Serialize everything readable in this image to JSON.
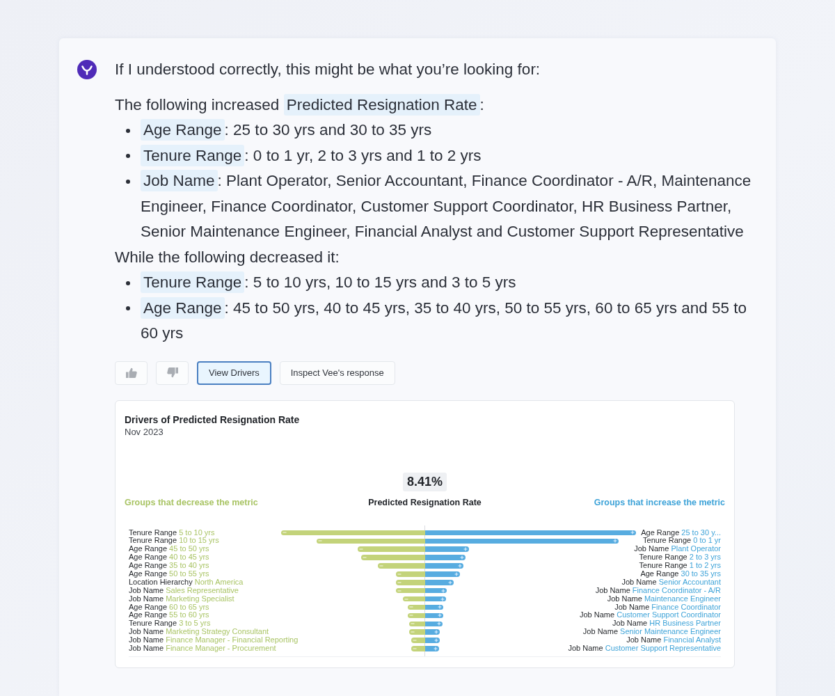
{
  "message": {
    "intro": "If I understood correctly, this might be what you’re looking for:",
    "sections": [
      {
        "lead": "The following increased",
        "metric": "Predicted Resignation Rate",
        "tail": ":",
        "items": [
          {
            "field": "Age Range",
            "text": ": 25 to 30 yrs and 30 to 35 yrs"
          },
          {
            "field": "Tenure Range",
            "text": ": 0 to 1 yr, 2 to 3 yrs and 1 to 2 yrs"
          },
          {
            "field": "Job Name",
            "text": ": Plant Operator, Senior Accountant, Finance Coordinator - A/R, Maintenance Engineer, Finance Coordinator, Customer Support Coordinator, HR Business Partner, Senior Maintenance Engineer, Financial Analyst and Customer Support Representative"
          }
        ]
      },
      {
        "lead": "While the following decreased it:",
        "items": [
          {
            "field": "Tenure Range",
            "text": ": 5 to 10 yrs, 10 to 15 yrs and 3 to 5 yrs"
          },
          {
            "field": "Age Range",
            "text": ": 45 to 50 yrs, 40 to 45 yrs, 35 to 40 yrs, 50 to 55 yrs, 60 to 65 yrs and 55 to 60 yrs"
          }
        ]
      }
    ]
  },
  "actions": [
    {
      "label": "View Drivers",
      "selected": true
    },
    {
      "label": "Inspect Vee's response",
      "selected": false
    }
  ],
  "chart": {
    "title": "Drivers of Predicted Resignation Rate",
    "period": "Nov 2023",
    "value": "8.41%",
    "metric": "Predicted Resignation Rate",
    "decrease_heading": "Groups that decrease the metric",
    "increase_heading": "Groups that increase the metric",
    "decrease_groups": [
      {
        "attribute": "Tenure Range",
        "group": "5 to 10 yrs"
      },
      {
        "attribute": "Tenure Range",
        "group": "10 to 15 yrs"
      },
      {
        "attribute": "Age Range",
        "group": "45 to 50 yrs"
      },
      {
        "attribute": "Age Range",
        "group": "40 to 45 yrs"
      },
      {
        "attribute": "Age Range",
        "group": "35 to 40 yrs"
      },
      {
        "attribute": "Age Range",
        "group": "50 to 55 yrs"
      },
      {
        "attribute": "Location Hierarchy",
        "group": "North America"
      },
      {
        "attribute": "Job Name",
        "group": "Sales Representative"
      },
      {
        "attribute": "Job Name",
        "group": "Marketing Specialist"
      },
      {
        "attribute": "Age Range",
        "group": "60 to 65 yrs"
      },
      {
        "attribute": "Age Range",
        "group": "55 to 60 yrs"
      },
      {
        "attribute": "Tenure Range",
        "group": "3 to 5 yrs"
      },
      {
        "attribute": "Job Name",
        "group": "Marketing Strategy Consultant"
      },
      {
        "attribute": "Job Name",
        "group": "Finance Manager - Financial Reporting"
      },
      {
        "attribute": "Job Name",
        "group": "Finance Manager - Procurement"
      }
    ],
    "increase_groups": [
      {
        "attribute": "Age Range",
        "group": "25 to 30 y..."
      },
      {
        "attribute": "Tenure Range",
        "group": "0 to 1 yr"
      },
      {
        "attribute": "Job Name",
        "group": "Plant Operator"
      },
      {
        "attribute": "Tenure Range",
        "group": "2 to 3 yrs"
      },
      {
        "attribute": "Tenure Range",
        "group": "1 to 2 yrs"
      },
      {
        "attribute": "Age Range",
        "group": "30 to 35 yrs"
      },
      {
        "attribute": "Job Name",
        "group": "Senior Accountant"
      },
      {
        "attribute": "Job Name",
        "group": "Finance Coordinator - A/R"
      },
      {
        "attribute": "Job Name",
        "group": "Maintenance Engineer"
      },
      {
        "attribute": "Job Name",
        "group": "Finance Coordinator"
      },
      {
        "attribute": "Job Name",
        "group": "Customer Support Coordinator"
      },
      {
        "attribute": "Job Name",
        "group": "HR Business Partner"
      },
      {
        "attribute": "Job Name",
        "group": "Senior Maintenance Engineer"
      },
      {
        "attribute": "Job Name",
        "group": "Financial Analyst"
      },
      {
        "attribute": "Job Name",
        "group": "Customer Support Representative"
      }
    ]
  }
}
